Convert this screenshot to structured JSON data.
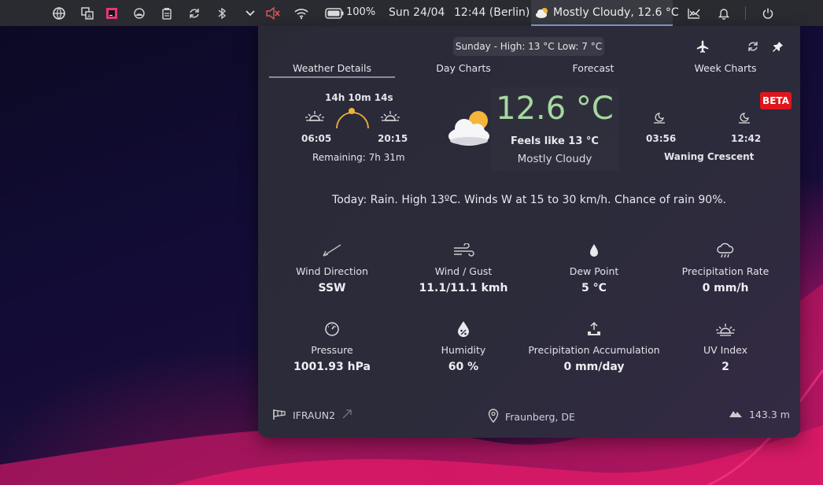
{
  "panel": {
    "date": "Sun 24/04",
    "time": "12:44 (Berlin)",
    "battery": "100%",
    "weather": "Mostly Cloudy, 12.6 °C"
  },
  "popup": {
    "day_summary": "Sunday - High: 13 °C Low: 7 °C",
    "tabs": [
      "Weather Details",
      "Day Charts",
      "Forecast",
      "Week Charts"
    ],
    "sun": {
      "day_length": "14h 10m 14s",
      "sunrise": "06:05",
      "sunset": "20:15",
      "remaining": "Remaining: 7h 31m"
    },
    "current": {
      "temperature": "12.6 °C",
      "feels_like": "Feels like 13 °C",
      "condition": "Mostly Cloudy"
    },
    "moon": {
      "moonrise": "03:56",
      "moonset": "12:42",
      "phase": "Waning Crescent"
    },
    "beta_badge": "BETA",
    "forecast_text": "Today: Rain. High 13ºC. Winds W at 15 to 30 km/h. Chance of rain 90%.",
    "metrics": [
      {
        "label": "Wind Direction",
        "value": "SSW"
      },
      {
        "label": "Wind / Gust",
        "value": "11.1/11.1 kmh"
      },
      {
        "label": "Dew Point",
        "value": "5 °C"
      },
      {
        "label": "Precipitation Rate",
        "value": "0 mm/h"
      },
      {
        "label": "Pressure",
        "value": "1001.93 hPa"
      },
      {
        "label": "Humidity",
        "value": "60 %"
      },
      {
        "label": "Precipitation Accumulation",
        "value": "0 mm/day"
      },
      {
        "label": "UV Index",
        "value": "2"
      }
    ],
    "footer": {
      "station": "IFRAUN2",
      "location": "Fraunberg, DE",
      "elevation": "143.3 m"
    }
  },
  "colors": {
    "temperature": "#a6d8a0",
    "beta": "#e0161c",
    "sun_arc": "#f2b13a"
  }
}
